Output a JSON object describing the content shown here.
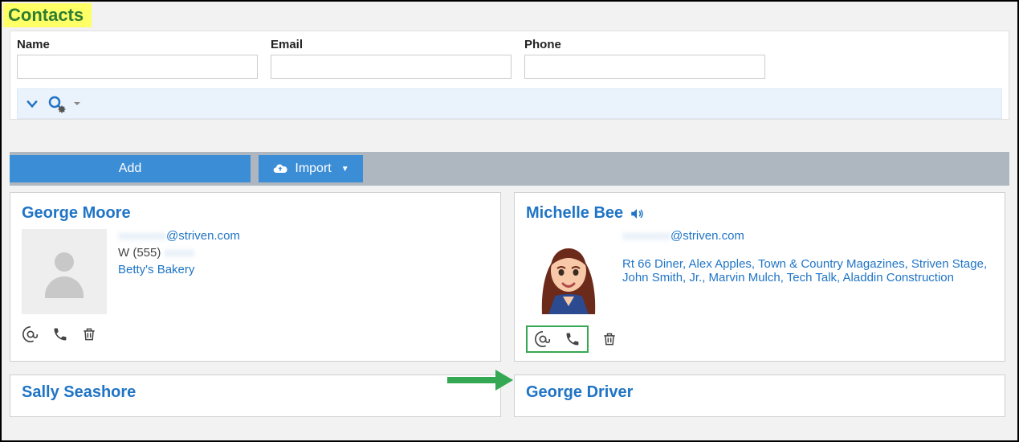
{
  "page": {
    "title": "Contacts"
  },
  "search": {
    "name_label": "Name",
    "email_label": "Email",
    "phone_label": "Phone",
    "name_value": "",
    "email_value": "",
    "phone_value": ""
  },
  "actions": {
    "add_label": "Add",
    "import_label": "Import"
  },
  "contacts": [
    {
      "name": "George Moore",
      "email_prefix": "xxxxxxxx",
      "email_suffix": "@striven.com",
      "phone_label": "W (555)",
      "phone_blur": "xxxxx",
      "orgs": "Betty's Bakery"
    },
    {
      "name": "Michelle Bee",
      "email_prefix": "xxxxxxxx",
      "email_suffix": "@striven.com",
      "orgs": "Rt 66 Diner, Alex Apples, Town & Country Magazines, Striven Stage, John Smith, Jr., Marvin Mulch, Tech Talk, Aladdin Construction"
    },
    {
      "name": "Sally Seashore"
    },
    {
      "name": "George Driver"
    }
  ]
}
